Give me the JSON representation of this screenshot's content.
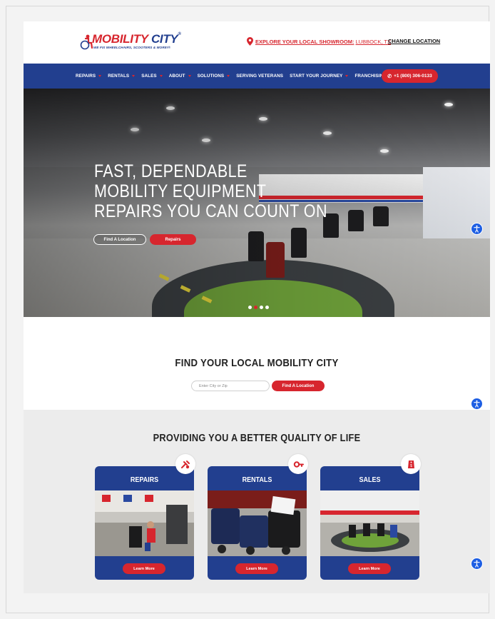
{
  "brand": {
    "name_part1": "MOBILITY",
    "name_part2": "CITY",
    "registered": "®",
    "tagline": "WE FIX WHEELCHAIRS, SCOOTERS & MORE!®"
  },
  "header": {
    "showroom_label": "EXPLORE YOUR LOCAL SHOWROOM:",
    "showroom_city": "LUBBOCK, TX",
    "change_location": "CHANGE LOCATION"
  },
  "nav": {
    "items": [
      {
        "label": "REPAIRS",
        "has_dropdown": true
      },
      {
        "label": "RENTALS",
        "has_dropdown": true
      },
      {
        "label": "SALES",
        "has_dropdown": true
      },
      {
        "label": "ABOUT",
        "has_dropdown": true
      },
      {
        "label": "SOLUTIONS",
        "has_dropdown": true
      },
      {
        "label": "SERVING VETERANS",
        "has_dropdown": false
      },
      {
        "label": "START YOUR JOURNEY",
        "has_dropdown": true
      },
      {
        "label": "FRANCHISING",
        "has_dropdown": false
      }
    ],
    "phone": "+1 (800) 306-0133"
  },
  "hero": {
    "title_lines": [
      "FAST, DEPENDABLE",
      "MOBILITY EQUIPMENT",
      "REPAIRS YOU CAN COUNT ON"
    ],
    "btn_location": "Find A Location",
    "btn_repairs": "Repairs",
    "slides": 4,
    "active_slide": 1
  },
  "find": {
    "title": "FIND YOUR LOCAL MOBILITY CITY",
    "placeholder": "Enter City or Zip",
    "button": "Find A Location"
  },
  "quality": {
    "title": "PROVIDING YOU A BETTER QUALITY OF LIFE",
    "cards": [
      {
        "title": "REPAIRS",
        "button": "Learn More",
        "icon": "repair-tools-icon"
      },
      {
        "title": "RENTALS",
        "button": "Learn More",
        "icon": "key-icon"
      },
      {
        "title": "SALES",
        "button": "Learn More",
        "icon": "price-tag-icon"
      }
    ]
  },
  "colors": {
    "brand_red": "#d7262e",
    "brand_blue": "#223f8f",
    "accessibility_blue": "#1d5ee3"
  }
}
